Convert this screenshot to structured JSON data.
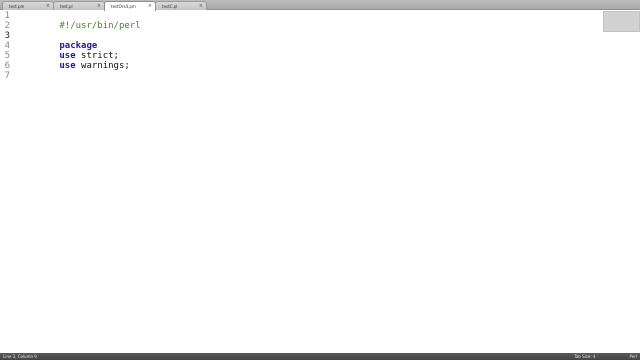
{
  "tabs": [
    {
      "label": "test.pm",
      "close": "×"
    },
    {
      "label": "test.pl",
      "close": "×"
    },
    {
      "label": "testOrs4.pm",
      "close": "×"
    },
    {
      "label": "testC.pl",
      "close": "×"
    }
  ],
  "active_tab": 2,
  "editor": {
    "current_line": 3,
    "line_numbers": [
      "1",
      "2",
      "3",
      "4",
      "5",
      "6",
      "7"
    ],
    "lines": {
      "shebang": "#!/usr/bin/perl",
      "package_kw": "package",
      "use1_kw": "use",
      "use1_rest": " strict;",
      "use2_kw": "use",
      "use2_rest": " warnings;"
    }
  },
  "status": {
    "position": "Line 3, Column 9",
    "tab_size": "Tab Size: 4",
    "syntax": "Perl"
  },
  "colors": {
    "comment": "#3a8a24",
    "keyword": "#1b1b9b",
    "statusbar": "#4d4d4d"
  }
}
